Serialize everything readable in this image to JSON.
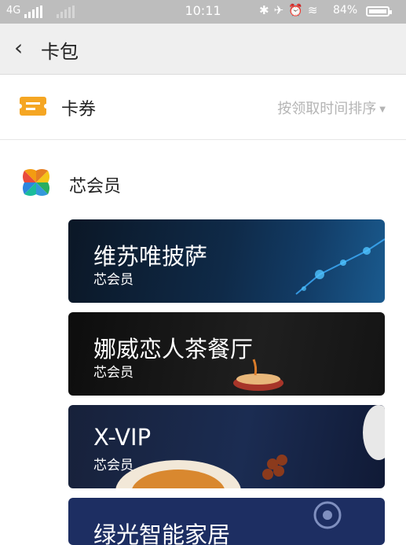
{
  "status_bar": {
    "network": "4G",
    "time": "10:11",
    "battery_percent": "84%"
  },
  "nav": {
    "title": "卡包"
  },
  "coupon_section": {
    "label": "卡券",
    "sort_label": "按领取时间排序"
  },
  "member_section": {
    "label": "芯会员"
  },
  "cards": [
    {
      "title": "维苏唯披萨",
      "subtitle": "芯会员"
    },
    {
      "title": "娜威恋人茶餐厅",
      "subtitle": "芯会员"
    },
    {
      "title": "X-VIP",
      "subtitle": "芯会员"
    },
    {
      "title": "绿光智能家居",
      "subtitle": ""
    }
  ],
  "colors": {
    "accent_orange": "#f5a623",
    "status_bar": "#bdbdbd",
    "nav_bar": "#efefef"
  }
}
